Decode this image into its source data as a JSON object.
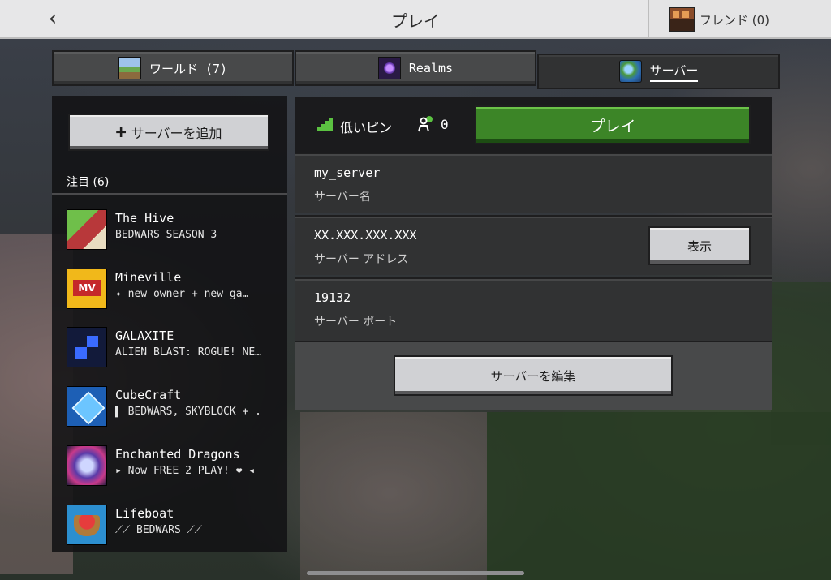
{
  "header": {
    "back_glyph": "‹",
    "title": "プレイ",
    "friends_label": "フレンド (0)"
  },
  "tabs": [
    {
      "label": "ワールド (7)",
      "icon": "world-icon",
      "active": false
    },
    {
      "label": "Realms",
      "icon": "realms-icon",
      "active": false
    },
    {
      "label": "サーバー",
      "icon": "globe-icon",
      "active": true
    }
  ],
  "sidebar": {
    "add_plus": "+",
    "add_label": "サーバーを追加",
    "section_label": "注目 (6)",
    "servers": [
      {
        "name": "The Hive",
        "desc": "BEDWARS SEASON 3",
        "icon": "the-hive-icon"
      },
      {
        "name": "Mineville",
        "desc": "✦ new owner + new ga…",
        "icon": "mineville-icon"
      },
      {
        "name": "GALAXITE",
        "desc": "ALIEN BLAST: ROGUE! NE…",
        "icon": "galaxite-icon"
      },
      {
        "name": "CubeCraft",
        "desc": "▌ BEDWARS, SKYBLOCK + .",
        "icon": "cubecraft-icon"
      },
      {
        "name": "Enchanted Dragons",
        "desc": "▸ Now FREE 2 PLAY! ❤ ◂",
        "icon": "enchanted-dragons-icon"
      },
      {
        "name": "Lifeboat",
        "desc": "⟋⟋ BEDWARS ⟋⟋",
        "icon": "lifeboat-icon"
      }
    ]
  },
  "detail": {
    "ping_label": "低いピン",
    "player_count": "0",
    "play_label": "プレイ",
    "server_name_value": "my_server",
    "server_name_label": "サーバー名",
    "address_value": "XX.XXX.XXX.XXX",
    "address_label": "サーバー アドレス",
    "show_label": "表示",
    "port_value": "19132",
    "port_label": "サーバー ポート",
    "edit_label": "サーバーを編集"
  },
  "colors": {
    "play_green": "#3c8527",
    "ping_green": "#5bc241",
    "panel_dark": "#313233",
    "button_light": "#d0d1d4"
  }
}
